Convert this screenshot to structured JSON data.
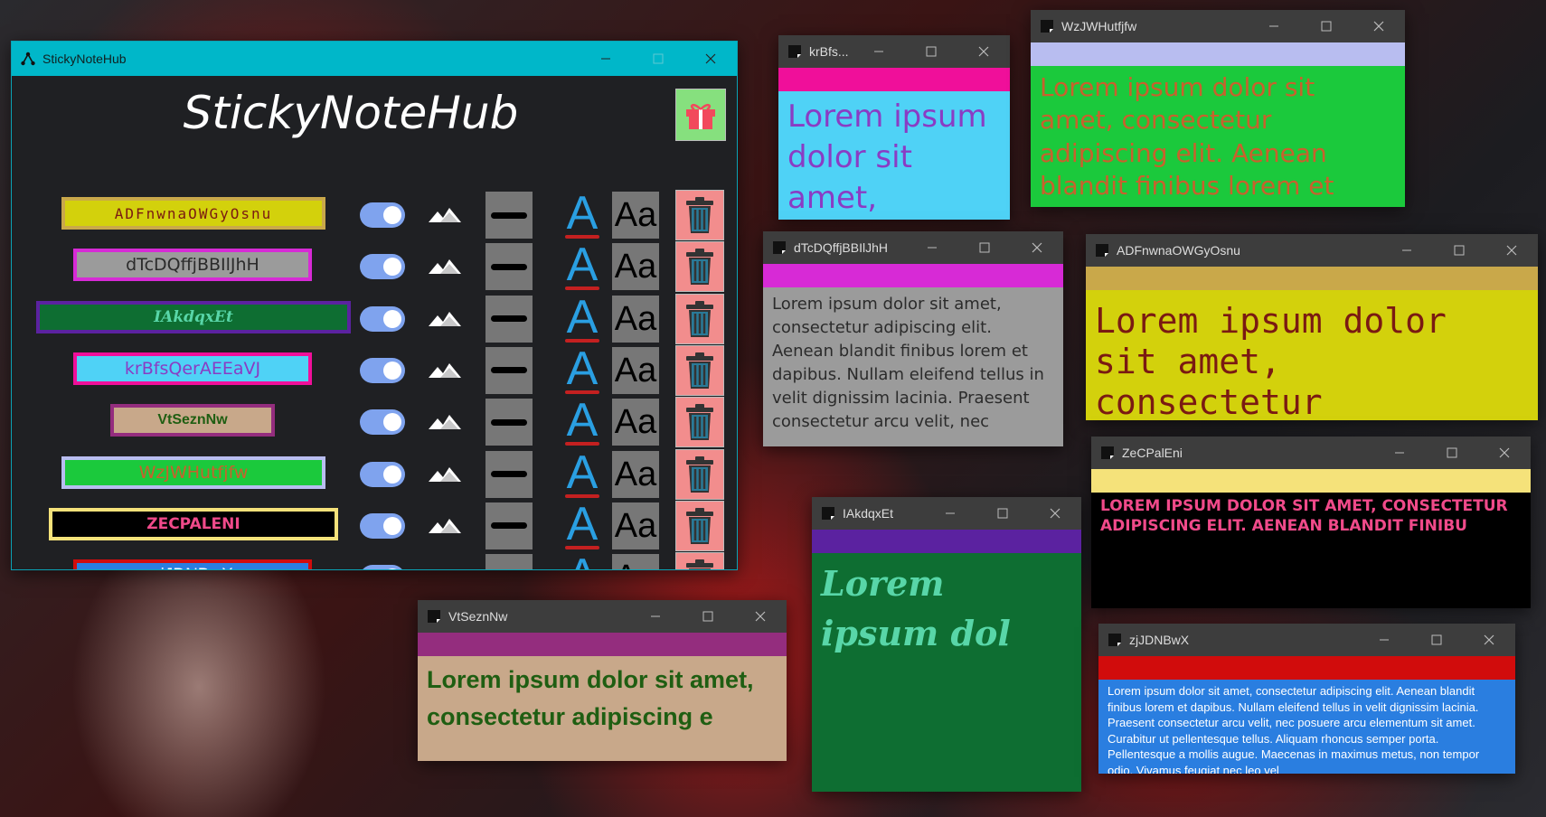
{
  "colors": {
    "accent": "#00b7c9",
    "note_titlebar": "#3d3d3d",
    "toggle_on": "#7fa3ee",
    "font_icon": "#2a9fe2"
  },
  "main_window": {
    "title": "StickyNoteHub",
    "app_title": "StickyNoteHub",
    "rows": [
      {
        "label": "ADFnwnaOWGyOsnu"
      },
      {
        "label": "dTcDQffjBBIlJhH"
      },
      {
        "label": "IAkdqxEt"
      },
      {
        "label": "krBfsQerAEEaVJ"
      },
      {
        "label": "VtSeznNw"
      },
      {
        "label": "WzJWHutfjfw"
      },
      {
        "label": "ZECPALENI"
      },
      {
        "label": "zjJDNBwX"
      }
    ],
    "font_icon_text": "A",
    "font_size_icon_text": "Aa"
  },
  "notes": [
    {
      "title": "krBfs...",
      "body": "Lorem ipsum dolor sit amet, consectetur"
    },
    {
      "title": "WzJWHutfjfw",
      "body": "Lorem ipsum dolor sit amet, consectetur adipiscing elit. Aenean blandit finibus lorem et"
    },
    {
      "title": "dTcDQffjBBIlJhH",
      "body": "Lorem ipsum dolor sit amet, consectetur adipiscing elit. Aenean blandit finibus lorem et dapibus. Nullam eleifend tellus in velit dignissim lacinia. Praesent consectetur arcu velit, nec"
    },
    {
      "title": "ADFnwnaOWGyOsnu",
      "body": "Lorem ipsum dolor sit amet, consectetur"
    },
    {
      "title": "ZeCPalEni",
      "body": "LOREM IPSUM DOLOR SIT AMET, CONSECTETUR ADIPISCING ELIT. AENEAN BLANDIT FINIBU"
    },
    {
      "title": "IAkdqxEt",
      "body": "Lorem ipsum dol"
    },
    {
      "title": "VtSeznNw",
      "body": "Lorem ipsum dolor sit amet, consectetur adipiscing e"
    },
    {
      "title": "zjJDNBwX",
      "body": "Lorem ipsum dolor sit amet, consectetur adipiscing elit. Aenean blandit finibus lorem et dapibus. Nullam eleifend tellus in velit dignissim lacinia. Praesent consectetur arcu velit, nec posuere arcu elementum sit amet. Curabitur ut pellentesque tellus. Aliquam rhoncus semper porta. Pellentesque a mollis augue. Maecenas in maximus metus, non tempor odio. Vivamus feugiat nec leo vel"
    }
  ]
}
